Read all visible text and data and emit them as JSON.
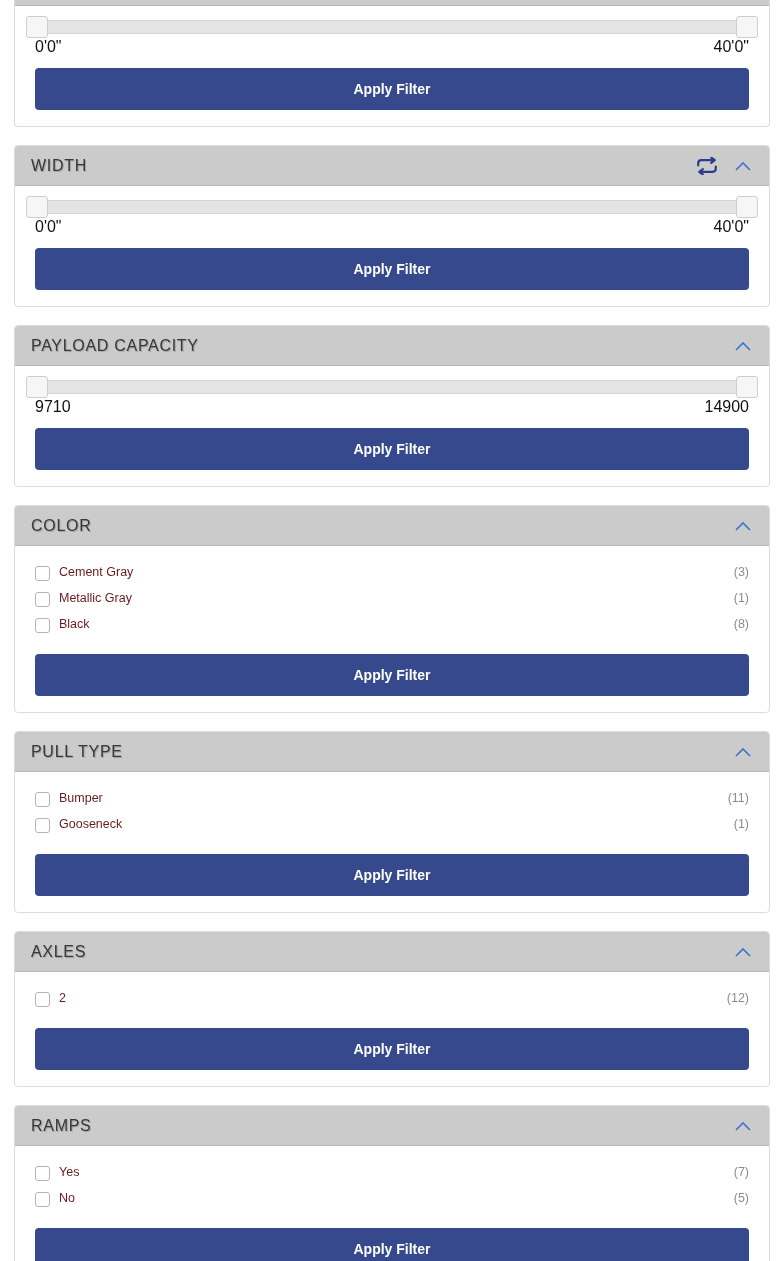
{
  "sections": [
    {
      "kind": "range",
      "expanded": true,
      "slider": {
        "thumbs": [
          {
            "level": 0
          },
          {
            "level": 1
          }
        ]
      },
      "min_label": "0'0\"",
      "max_label": "40'0\"",
      "button": "Apply Filter"
    },
    {
      "kind": "range",
      "title": "WIDTH",
      "expanded": true,
      "swap_icon": true,
      "slider": {
        "thumbs": [
          {
            "level": 0
          },
          {
            "level": 1
          }
        ]
      },
      "min_label": "0'0\"",
      "max_label": "40'0\"",
      "button": "Apply Filter"
    },
    {
      "kind": "range",
      "title": "PAYLOAD CAPACITY",
      "expanded": true,
      "swap_icon": false,
      "slider": {
        "thumbs": [
          {
            "level": 0
          },
          {
            "level": 1
          }
        ]
      },
      "min_label": "9710",
      "max_label": "14900",
      "button": "Apply Filter"
    },
    {
      "kind": "checklist",
      "title": "COLOR",
      "expanded": true,
      "swap_icon": false,
      "options": [
        {
          "label": "Cement Gray",
          "count": "(3)",
          "checked": false
        },
        {
          "label": "Metallic Gray",
          "count": "(1)",
          "checked": false
        },
        {
          "label": "Black",
          "count": "(8)",
          "checked": false
        }
      ],
      "button": "Apply Filter"
    },
    {
      "kind": "checklist",
      "title": "PULL TYPE",
      "expanded": true,
      "swap_icon": false,
      "options": [
        {
          "label": "Bumper",
          "count": "(11)",
          "checked": false
        },
        {
          "label": "Gooseneck",
          "count": "(1)",
          "checked": false
        }
      ],
      "button": "Apply Filter"
    },
    {
      "kind": "checklist",
      "title": "AXLES",
      "expanded": true,
      "swap_icon": false,
      "options": [
        {
          "label": "2",
          "count": "(12)",
          "checked": false
        }
      ],
      "button": "Apply Filter"
    },
    {
      "kind": "checklist",
      "title": "RAMPS",
      "expanded": true,
      "swap_icon": false,
      "options": [
        {
          "label": "Yes",
          "count": "(7)",
          "checked": false
        },
        {
          "label": "No",
          "count": "(5)",
          "checked": false
        }
      ],
      "button": "Apply Filter"
    }
  ]
}
